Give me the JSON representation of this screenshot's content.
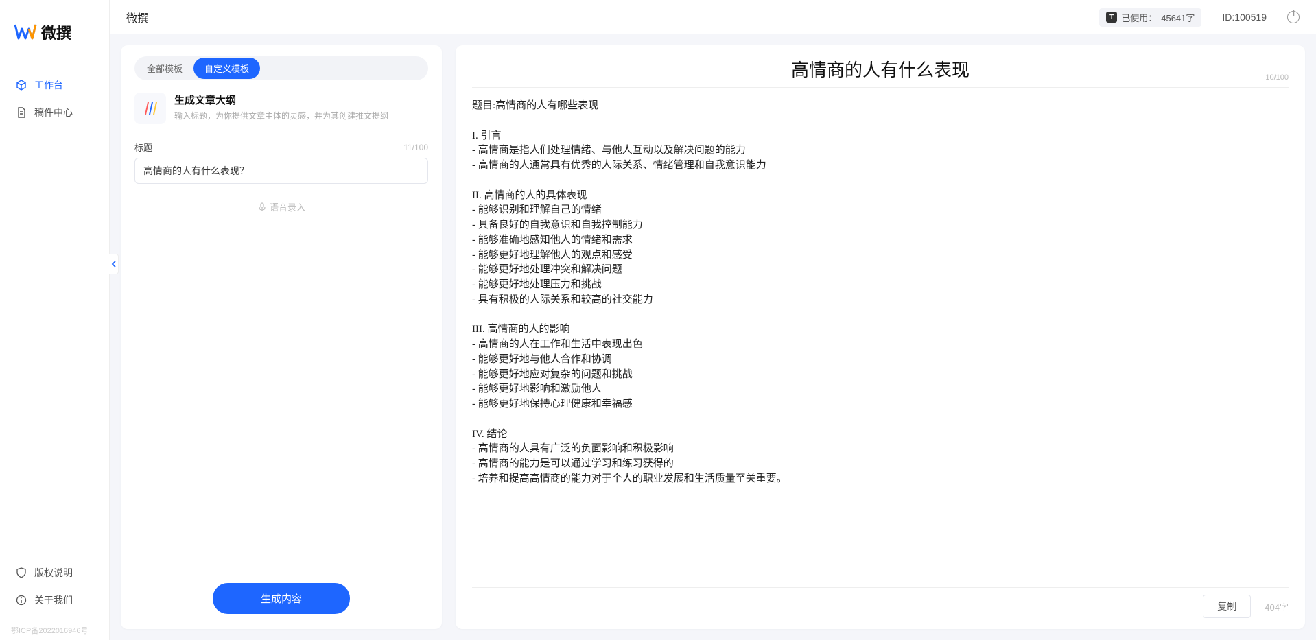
{
  "app_name": "微撰",
  "logo_text": "微撰",
  "sidebar": {
    "nav": [
      {
        "label": "工作台",
        "active": true
      },
      {
        "label": "稿件中心",
        "active": false
      }
    ],
    "bottom": [
      {
        "label": "版权说明"
      },
      {
        "label": "关于我们"
      }
    ],
    "icp": "鄂ICP备2022016946号"
  },
  "topbar": {
    "title": "微撰",
    "usage_prefix": "已使用：",
    "usage_value": "45641字",
    "user_id_label": "ID:100519"
  },
  "left": {
    "tabs": [
      {
        "label": "全部模板",
        "active": false
      },
      {
        "label": "自定义模板",
        "active": true
      }
    ],
    "template": {
      "title": "生成文章大纲",
      "desc": "输入标题，为你提供文章主体的灵感，并为其创建推文提纲"
    },
    "field_label": "标题",
    "field_counter": "11/100",
    "field_value": "高情商的人有什么表现？",
    "voice_entry": "语音录入",
    "generate_label": "生成内容"
  },
  "right": {
    "title": "高情商的人有什么表现",
    "title_counter": "10/100",
    "body": "题目:高情商的人有哪些表现\n\nI. 引言\n- 高情商是指人们处理情绪、与他人互动以及解决问题的能力\n- 高情商的人通常具有优秀的人际关系、情绪管理和自我意识能力\n\nII. 高情商的人的具体表现\n- 能够识别和理解自己的情绪\n- 具备良好的自我意识和自我控制能力\n- 能够准确地感知他人的情绪和需求\n- 能够更好地理解他人的观点和感受\n- 能够更好地处理冲突和解决问题\n- 能够更好地处理压力和挑战\n- 具有积极的人际关系和较高的社交能力\n\nIII. 高情商的人的影响\n- 高情商的人在工作和生活中表现出色\n- 能够更好地与他人合作和协调\n- 能够更好地应对复杂的问题和挑战\n- 能够更好地影响和激励他人\n- 能够更好地保持心理健康和幸福感\n\nIV. 结论\n- 高情商的人具有广泛的负面影响和积极影响\n- 高情商的能力是可以通过学习和练习获得的\n- 培养和提高高情商的能力对于个人的职业发展和生活质量至关重要。",
    "copy_label": "复制",
    "char_count": "404字"
  }
}
